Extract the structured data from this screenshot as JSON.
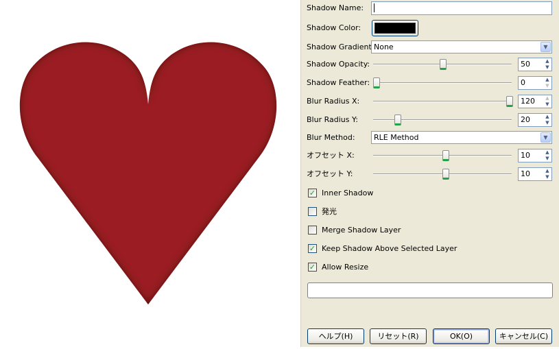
{
  "preview": {
    "shape_icon": "heart-shape",
    "fill_color": "#9b1f22",
    "shadow_color": "#2a0808"
  },
  "form": {
    "shadow_name": {
      "label": "Shadow Name:",
      "value": ""
    },
    "shadow_color": {
      "label": "Shadow Color:",
      "swatch": "#000000"
    },
    "shadow_gradient": {
      "label": "Shadow Gradient:",
      "value": "None"
    },
    "shadow_opacity": {
      "label": "Shadow Opacity:",
      "value": "50",
      "level": 0.5
    },
    "shadow_feather": {
      "label": "Shadow Feather:",
      "value": "0",
      "level": 0.0
    },
    "blur_radius_x": {
      "label": "Blur Radius X:",
      "value": "120",
      "level": 1.0
    },
    "blur_radius_y": {
      "label": "Blur Radius Y:",
      "value": "20",
      "level": 0.167
    },
    "blur_method": {
      "label": "Blur Method:",
      "value": "RLE Method"
    },
    "offset_x": {
      "label": "オフセット X:",
      "value": "10",
      "level": 0.52
    },
    "offset_y": {
      "label": "オフセット Y:",
      "value": "10",
      "level": 0.52
    }
  },
  "checkboxes": [
    {
      "label": "Inner Shadow",
      "checked": true
    },
    {
      "label": "発光",
      "checked": false
    },
    {
      "label": "Merge Shadow Layer",
      "checked": false
    },
    {
      "label": "Keep Shadow Above Selected Layer",
      "checked": true
    },
    {
      "label": "Allow Resize",
      "checked": true
    }
  ],
  "status_field": {
    "value": ""
  },
  "buttons": {
    "help": "ヘルプ(H)",
    "reset": "リセット(R)",
    "ok": "OK(O)",
    "cancel": "キャンセル(C)"
  }
}
